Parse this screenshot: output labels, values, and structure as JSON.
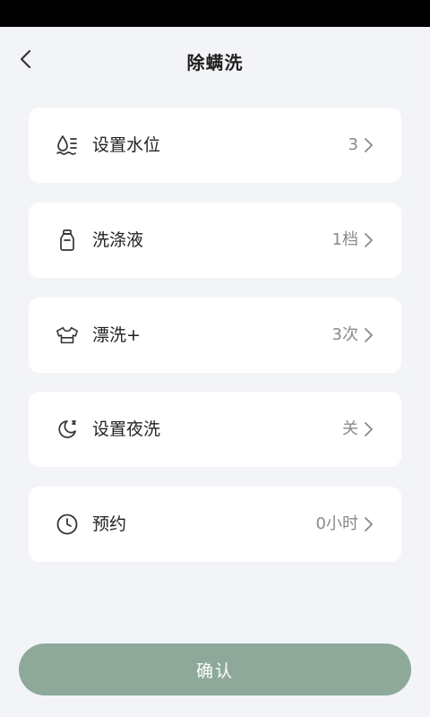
{
  "header": {
    "title": "除螨洗"
  },
  "settings": [
    {
      "icon": "water-level-icon",
      "label": "设置水位",
      "value": "3"
    },
    {
      "icon": "detergent-bottle-icon",
      "label": "洗涤液",
      "value": "1档"
    },
    {
      "icon": "shirt-icon",
      "label": "漂洗+",
      "value": "3次"
    },
    {
      "icon": "moon-icon",
      "label": "设置夜洗",
      "value": "关"
    },
    {
      "icon": "clock-icon",
      "label": "预约",
      "value": "0小时"
    }
  ],
  "confirm": {
    "label": "确认"
  },
  "colors": {
    "background": "#f3f4f7",
    "card": "#ffffff",
    "confirm_button": "#8ea99a",
    "value_text": "#8a8a8a"
  }
}
